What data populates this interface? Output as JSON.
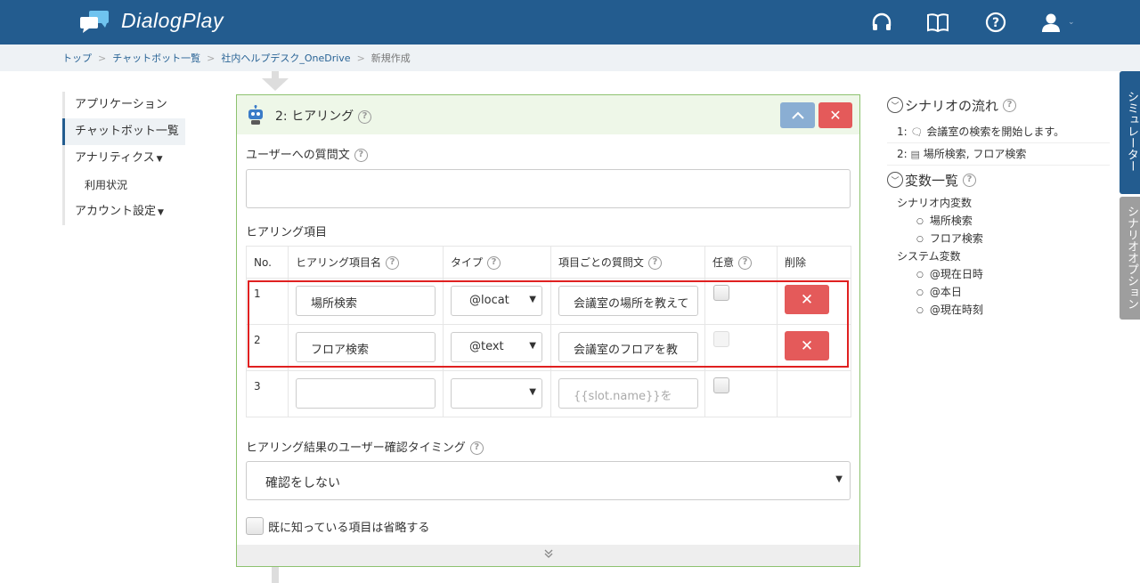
{
  "app": {
    "title": "DialogPlay"
  },
  "colors": {
    "header": "#235c8f",
    "panel_border": "#8dc26f",
    "danger": "#e45a5a",
    "highlight": "#e02020"
  },
  "header_icons": [
    "headset-icon",
    "book-icon",
    "help-icon",
    "user-icon"
  ],
  "breadcrumb": [
    "トップ",
    "チャットボット一覧",
    "社内ヘルプデスク_OneDrive",
    "新規作成"
  ],
  "sidebar": {
    "items": [
      {
        "label": "アプリケーション"
      },
      {
        "label": "チャットボット一覧",
        "active": true
      },
      {
        "label": "アナリティクス"
      },
      {
        "label": "利用状況"
      },
      {
        "label": "アカウント設定"
      }
    ]
  },
  "panel": {
    "title": "2: ヒアリング",
    "question_label": "ユーザーへの質問文",
    "question_value": "",
    "items_label": "ヒアリング項目",
    "columns": [
      "No.",
      "ヒアリング項目名",
      "タイプ",
      "項目ごとの質問文",
      "任意",
      "削除"
    ],
    "rows": [
      {
        "no": "1",
        "name": "場所検索",
        "type": "@locat",
        "question": "会議室の場所を教えて",
        "optional": false,
        "deletable": true
      },
      {
        "no": "2",
        "name": "フロア検索",
        "type": "@text",
        "question": "会議室のフロアを教",
        "optional": false,
        "deletable": true
      },
      {
        "no": "3",
        "name": "",
        "type": "",
        "question_placeholder": "{{slot.name}}を",
        "optional": false,
        "deletable": false
      }
    ],
    "confirm_label": "ヒアリング結果のユーザー確認タイミング",
    "confirm_value": "確認をしない",
    "skip_label": "既に知っている項目は省略する"
  },
  "right_pane": {
    "flow_title": "シナリオの流れ",
    "flow_items": [
      {
        "no": "1:",
        "text": "会議室の検索を開始します。"
      },
      {
        "no": "2:",
        "text": "場所検索, フロア検索"
      }
    ],
    "vars_title": "変数一覧",
    "scenario_vars_label": "シナリオ内変数",
    "scenario_vars": [
      "場所検索",
      "フロア検索"
    ],
    "system_vars_label": "システム変数",
    "system_vars": [
      "@現在日時",
      "@本日",
      "@現在時刻"
    ]
  },
  "side_tabs": {
    "simulator": "シミュレーター",
    "options": "シナリオオプション"
  }
}
